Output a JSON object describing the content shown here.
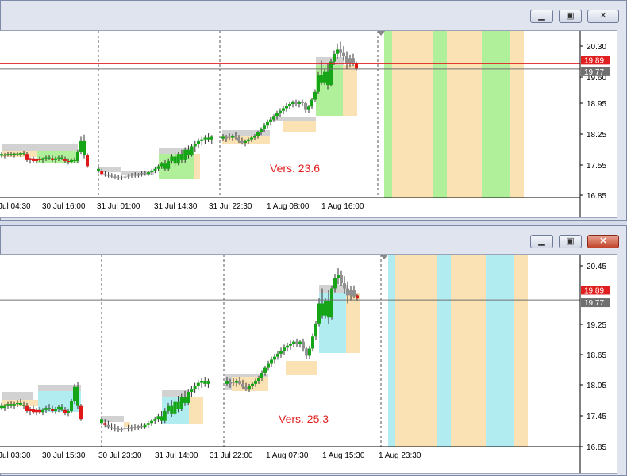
{
  "windows": [
    {
      "controls": {
        "minimize": "minimize-icon",
        "maximize": "maximize-icon",
        "close": "close-icon"
      },
      "version_label": "Vers. 23.6",
      "chart_data": {
        "type": "candlestick",
        "y_ticks": [
          "20.30",
          "19.60",
          "18.95",
          "18.25",
          "17.55",
          "16.85"
        ],
        "x_ticks": [
          "Jul 04:30",
          "30 Jul 16:00",
          "31 Jul 01:00",
          "31 Jul 14:30",
          "31 Jul 22:30",
          "1 Aug 08:00",
          "1 Aug 16:00"
        ],
        "ylim": [
          16.85,
          20.55
        ],
        "price_labels": [
          {
            "value": 19.89,
            "text": "19.89",
            "color": "#e02020"
          },
          {
            "value": 19.77,
            "text": "19.77",
            "color": "#707070"
          }
        ],
        "zone_colors": {
          "green": "#b0f09a",
          "orange": "#fbe2b5",
          "gray": "#d2d2d2"
        }
      }
    },
    {
      "controls": {
        "minimize": "minimize-icon",
        "maximize": "maximize-icon",
        "close": "close-icon"
      },
      "version_label": "Vers. 25.3",
      "chart_data": {
        "type": "candlestick",
        "y_ticks": [
          "20.45",
          "19.25",
          "18.65",
          "18.05",
          "17.45",
          "16.85"
        ],
        "x_ticks": [
          "Jul 03:30",
          "30 Jul 15:30",
          "30 Jul 23:30",
          "31 Jul 14:00",
          "31 Jul 22:00",
          "1 Aug 07:30",
          "1 Aug 15:30",
          "1 Aug 23:30"
        ],
        "ylim": [
          16.85,
          20.6
        ],
        "price_labels": [
          {
            "value": 19.89,
            "text": "19.89",
            "color": "#e02020"
          },
          {
            "value": 19.77,
            "text": "19.77",
            "color": "#707070"
          }
        ],
        "zone_colors": {
          "cyan": "#b0ecf0",
          "orange": "#fbe2b5",
          "gray": "#d2d2d2"
        }
      }
    }
  ]
}
